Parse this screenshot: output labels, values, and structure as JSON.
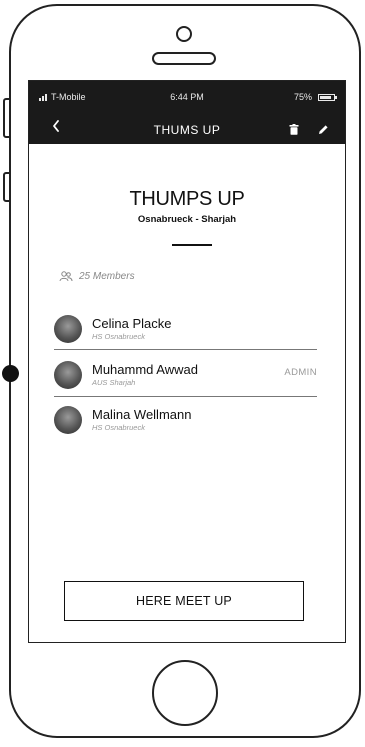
{
  "status_bar": {
    "carrier": "T-Mobile",
    "time": "6:44 PM",
    "battery_percent": "75%",
    "battery_level": 0.75
  },
  "nav": {
    "back_icon": "chevron-left-icon",
    "title": "THUMS UP",
    "actions": [
      "trash-icon",
      "pencil-icon"
    ]
  },
  "group": {
    "title": "THUMPS UP",
    "subtitle": "Osnabrueck - Sharjah"
  },
  "members": {
    "count_label": "25 Members",
    "icon": "people-icon",
    "list": [
      {
        "name": "Celina Placke",
        "org": "HS Osnabrueck",
        "role": ""
      },
      {
        "name": "Muhammd Awwad",
        "org": "AUS Sharjah",
        "role": "ADMIN"
      },
      {
        "name": "Malina Wellmann",
        "org": "HS Osnabrueck",
        "role": ""
      }
    ]
  },
  "cta": {
    "label": "HERE MEET UP"
  },
  "colors": {
    "bar": "#1a1a1a",
    "text": "#111111",
    "muted": "#999999",
    "background": "#ffffff"
  }
}
